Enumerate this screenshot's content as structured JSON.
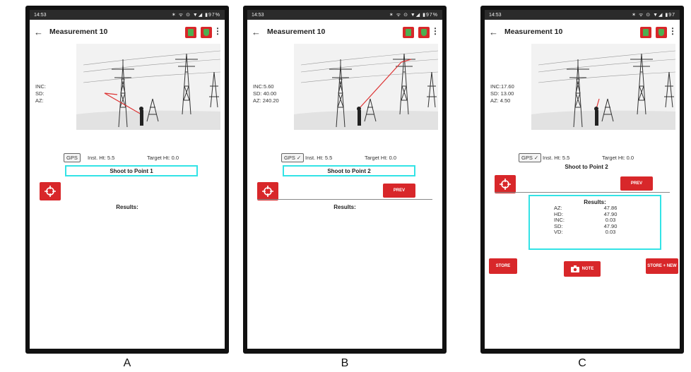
{
  "screens": [
    {
      "id": "A",
      "status_time": "14:53",
      "status_icons": "✶ ᯤ ⊙ ▼◢ ▮97%",
      "title": "Measurement 10",
      "readout": {
        "inc": "INC:",
        "sd": "SD:",
        "az": "AZ:"
      },
      "gps": "GPS",
      "inst_ht": "Inst. Ht: 5.5",
      "target_ht": "Target Ht: 0.0",
      "shoot": "Shoot to Point 1",
      "results_label": "Results:"
    },
    {
      "id": "B",
      "status_time": "14:53",
      "status_icons": "✶ ᯤ ⊙ ▼◢ ▮97%",
      "title": "Measurement 10",
      "readout": {
        "inc": "INC:5.60",
        "sd": "SD: 40.00",
        "az": "AZ: 240.20"
      },
      "gps": "GPS ✓",
      "inst_ht": "Inst. Ht: 5.5",
      "target_ht": "Target Ht: 0.0",
      "shoot": "Shoot to Point 2",
      "prev": "PREV",
      "results_label": "Results:"
    },
    {
      "id": "C",
      "status_time": "14:53",
      "status_icons": "✶ ᯤ ⊙ ▼◢ ▮97",
      "title": "Measurement 10",
      "readout": {
        "inc": "INC:17.60",
        "sd": "SD: 13.00",
        "az": "AZ: 4.50"
      },
      "gps": "GPS ✓",
      "inst_ht": "Inst. Ht: 5.5",
      "target_ht": "Target Ht: 0.0",
      "shoot": "Shoot to Point 2",
      "prev": "PREV",
      "results_title": "Results:",
      "results": [
        {
          "k": "AZ:",
          "v": "47.86"
        },
        {
          "k": "HD:",
          "v": "47.90"
        },
        {
          "k": "INC:",
          "v": "0.03"
        },
        {
          "k": "SD:",
          "v": "47.90"
        },
        {
          "k": "VD:",
          "v": "0.03"
        }
      ],
      "store": "STORE",
      "note": "NOTE",
      "store_new": "STORE + NEW"
    }
  ],
  "captions": [
    "A",
    "B",
    "C"
  ],
  "colors": {
    "accent_red": "#d8272a",
    "highlight": "#33e3e6",
    "icon_green": "#4caf50"
  }
}
